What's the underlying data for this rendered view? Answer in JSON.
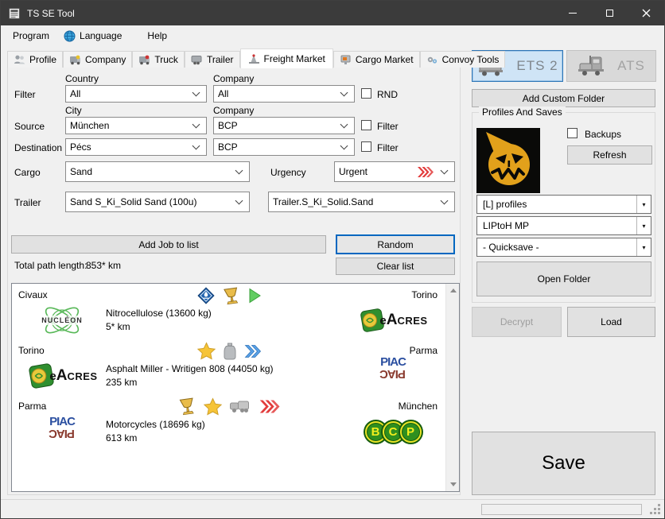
{
  "window": {
    "title": "TS SE Tool"
  },
  "menu": {
    "program": "Program",
    "language": "Language",
    "help": "Help"
  },
  "tabs": {
    "profile": "Profile",
    "company": "Company",
    "truck": "Truck",
    "trailer": "Trailer",
    "freight": "Freight Market",
    "cargo": "Cargo Market",
    "convoy": "Convoy Tools"
  },
  "freight": {
    "row_labels": {
      "filter": "Filter",
      "source": "Source",
      "destination": "Destination",
      "cargo": "Cargo",
      "urgency": "Urgency",
      "trailer": "Trailer"
    },
    "col_labels": {
      "country": "Country",
      "city": "City",
      "company": "Company"
    },
    "filter_row": {
      "country": "All",
      "company": "All",
      "rnd": "RND"
    },
    "source_row": {
      "city": "München",
      "company": "BCP",
      "filter": "Filter"
    },
    "dest_row": {
      "city": "Pécs",
      "company": "BCP",
      "filter": "Filter"
    },
    "cargo_row": {
      "cargo": "Sand",
      "urgency": "Urgent"
    },
    "trailer_row": {
      "trailer": "Sand S_Ki_Solid Sand (100u)",
      "definition": "Trailer.S_Ki_Solid.Sand"
    },
    "add_job_button": "Add Job to list",
    "random_button": "Random",
    "clear_button": "Clear list",
    "total_path_label": "Total path length:",
    "total_path_value": "853* km",
    "jobs": [
      {
        "from": "Civaux",
        "to": "Torino",
        "cargo": "Nitrocellulose (13600 kg)",
        "distance": "5* km",
        "from_company": "NUCLÉON",
        "to_company": "eACRES",
        "icons": [
          "adr-diamond-icon",
          "trophy-icon",
          "play-icon"
        ]
      },
      {
        "from": "Torino",
        "to": "Parma",
        "cargo": "Asphalt Miller - Writigen 808 (44050 kg)",
        "distance": "235 km",
        "from_company": "eACRES",
        "to_company": "PIAC",
        "icons": [
          "star-icon",
          "jug-icon",
          "fast-delivery-icon"
        ]
      },
      {
        "from": "Parma",
        "to": "München",
        "cargo": "Motorcycles (18696 kg)",
        "distance": "613 km",
        "from_company": "PIAC",
        "to_company": "BCP",
        "icons": [
          "trophy-icon",
          "star-icon",
          "truck-icon",
          "urgent-icon"
        ]
      }
    ]
  },
  "logos": {
    "nucleon": "NUCLÉON",
    "eacres": {
      "e": "e",
      "a": "A",
      "rest": "CRES"
    },
    "piac": "PIAC",
    "bcp": [
      "B",
      "C",
      "P"
    ]
  },
  "sidebar": {
    "ets2_button": "ETS 2",
    "ats_button": "ATS",
    "add_custom_folder_button": "Add Custom Folder",
    "group_title": "Profiles And Saves",
    "backups_label": "Backups",
    "refresh_button": "Refresh",
    "profiles_dropdown": "[L] profiles",
    "profile_dropdown": "LIPtoH MP",
    "save_dropdown": "- Quicksave -",
    "open_folder_button": "Open Folder",
    "decrypt_button": "Decrypt",
    "load_button": "Load",
    "save_button": "Save"
  },
  "colors": {
    "titlebar": "#3b3b3b",
    "accent": "#0067c0",
    "urgent_red": "#e23c3c",
    "ets2_bg": "#cfe4f6",
    "ets2_border": "#2e75b6",
    "avatar_yellow": "#e2a11b",
    "nucleon_green": "#58b858",
    "eacres_green": "#2f8f2f",
    "piac_blue": "#2b4fa0",
    "piac_red": "#8a3a2e",
    "bcp_green": "#2f8f1f",
    "bcp_yellow": "#f2ee1e"
  }
}
